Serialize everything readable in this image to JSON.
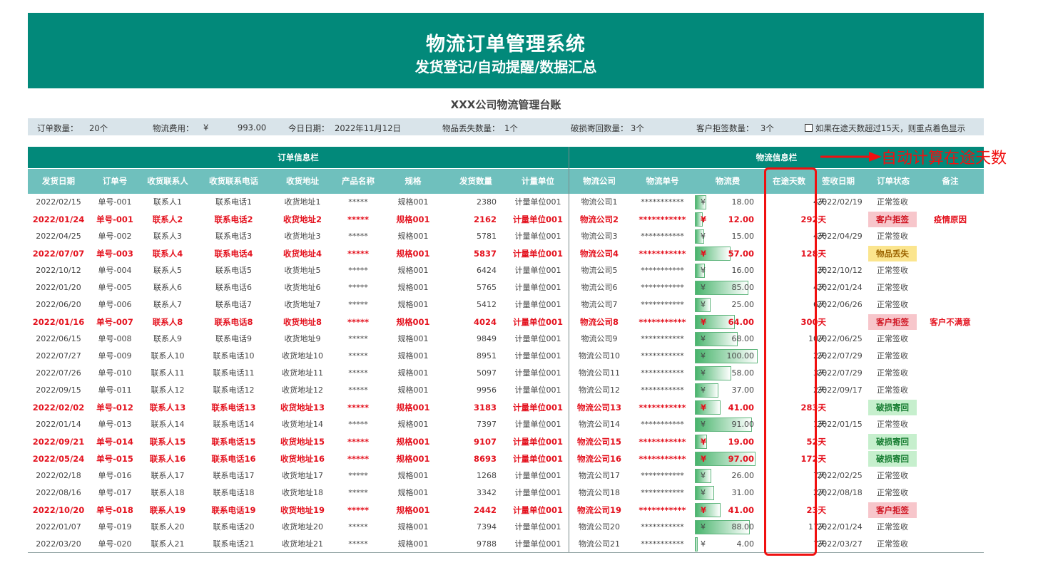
{
  "banner": {
    "title": "物流订单管理系统",
    "subtitle": "发货登记/自动提醒/数据汇总"
  },
  "ledger_title": "XXX公司物流管理台账",
  "summary": {
    "order_count_label": "订单数量：",
    "order_count": "20个",
    "fee_label": "物流费用：",
    "fee_currency": "¥",
    "fee_value": "993.00",
    "today_label": "今日日期：",
    "today_value": "2022年11月12日",
    "lost_label": "物品丢失数量：",
    "lost_value": "1个",
    "damaged_label": "破损寄回数量：",
    "damaged_value": "3个",
    "rejected_label": "客户拒签数量：",
    "rejected_value": "3个",
    "highlight_option": "如果在途天数超过15天，则重点着色显示"
  },
  "sections": {
    "order": "订单信息栏",
    "logistics": "物流信息栏"
  },
  "columns": [
    "发货日期",
    "订单号",
    "收货联系人",
    "收货联系电话",
    "收货地址",
    "产品名称",
    "规格",
    "发货数量",
    "计量单位",
    "物流公司",
    "物流单号",
    "物流费",
    "在途天数",
    "签收日期",
    "订单状态",
    "备注"
  ],
  "annotation": "自动计算在途天数",
  "colors": {
    "header_dark": "#02897a",
    "header_light": "#6fc0bd",
    "highlight_text": "#e4121e",
    "annotation": "#f01010"
  },
  "fee_max": 100,
  "rows": [
    {
      "hl": false,
      "date": "2022/02/15",
      "order": "单号-001",
      "contact": "联系人1",
      "phone": "联系电话1",
      "addr": "收货地址1",
      "product": "*****",
      "spec": "规格001",
      "qty": "2380",
      "unit": "计量单位001",
      "company": "物流公司1",
      "track": "***********",
      "yen": "¥",
      "fee": "18.00",
      "fee_value": 18,
      "days": "4天",
      "sign": "2022/02/19",
      "status": "正常签收",
      "status_type": "",
      "note": ""
    },
    {
      "hl": true,
      "date": "2022/01/24",
      "order": "单号-001",
      "contact": "联系人2",
      "phone": "联系电话2",
      "addr": "收货地址2",
      "product": "*****",
      "spec": "规格001",
      "qty": "2162",
      "unit": "计量单位001",
      "company": "物流公司2",
      "track": "***********",
      "yen": "¥",
      "fee": "12.00",
      "fee_value": 12,
      "days": "292天",
      "sign": "",
      "status": "客户拒签",
      "status_type": "reject",
      "note": "疫情原因"
    },
    {
      "hl": false,
      "date": "2022/04/25",
      "order": "单号-002",
      "contact": "联系人3",
      "phone": "联系电话3",
      "addr": "收货地址3",
      "product": "*****",
      "spec": "规格001",
      "qty": "5781",
      "unit": "计量单位001",
      "company": "物流公司3",
      "track": "***********",
      "yen": "¥",
      "fee": "15.00",
      "fee_value": 15,
      "days": "4天",
      "sign": "2022/04/29",
      "status": "正常签收",
      "status_type": "",
      "note": ""
    },
    {
      "hl": true,
      "date": "2022/07/07",
      "order": "单号-003",
      "contact": "联系人4",
      "phone": "联系电话4",
      "addr": "收货地址4",
      "product": "*****",
      "spec": "规格001",
      "qty": "5837",
      "unit": "计量单位001",
      "company": "物流公司4",
      "track": "***********",
      "yen": "¥",
      "fee": "57.00",
      "fee_value": 57,
      "days": "128天",
      "sign": "",
      "status": "物品丢失",
      "status_type": "lost",
      "note": ""
    },
    {
      "hl": false,
      "date": "2022/10/12",
      "order": "单号-004",
      "contact": "联系人5",
      "phone": "联系电话5",
      "addr": "收货地址5",
      "product": "*****",
      "spec": "规格001",
      "qty": "6424",
      "unit": "计量单位001",
      "company": "物流公司5",
      "track": "***********",
      "yen": "¥",
      "fee": "16.00",
      "fee_value": 16,
      "days": "天",
      "sign": "2022/10/12",
      "status": "正常签收",
      "status_type": "",
      "note": ""
    },
    {
      "hl": false,
      "date": "2022/01/20",
      "order": "单号-005",
      "contact": "联系人6",
      "phone": "联系电话6",
      "addr": "收货地址6",
      "product": "*****",
      "spec": "规格001",
      "qty": "5765",
      "unit": "计量单位001",
      "company": "物流公司6",
      "track": "***********",
      "yen": "¥",
      "fee": "85.00",
      "fee_value": 85,
      "days": "4天",
      "sign": "2022/01/24",
      "status": "正常签收",
      "status_type": "",
      "note": ""
    },
    {
      "hl": false,
      "date": "2022/06/20",
      "order": "单号-006",
      "contact": "联系人7",
      "phone": "联系电话7",
      "addr": "收货地址7",
      "product": "*****",
      "spec": "规格001",
      "qty": "5412",
      "unit": "计量单位001",
      "company": "物流公司7",
      "track": "***********",
      "yen": "¥",
      "fee": "25.00",
      "fee_value": 25,
      "days": "6天",
      "sign": "2022/06/26",
      "status": "正常签收",
      "status_type": "",
      "note": ""
    },
    {
      "hl": true,
      "date": "2022/01/16",
      "order": "单号-007",
      "contact": "联系人8",
      "phone": "联系电话8",
      "addr": "收货地址8",
      "product": "*****",
      "spec": "规格001",
      "qty": "4024",
      "unit": "计量单位001",
      "company": "物流公司8",
      "track": "***********",
      "yen": "¥",
      "fee": "64.00",
      "fee_value": 64,
      "days": "300天",
      "sign": "",
      "status": "客户拒签",
      "status_type": "reject",
      "note": "客户不满意"
    },
    {
      "hl": false,
      "date": "2022/06/15",
      "order": "单号-008",
      "contact": "联系人9",
      "phone": "联系电话9",
      "addr": "收货地址9",
      "product": "*****",
      "spec": "规格001",
      "qty": "9849",
      "unit": "计量单位001",
      "company": "物流公司9",
      "track": "***********",
      "yen": "¥",
      "fee": "68.00",
      "fee_value": 68,
      "days": "10天",
      "sign": "2022/06/25",
      "status": "正常签收",
      "status_type": "",
      "note": ""
    },
    {
      "hl": false,
      "date": "2022/07/27",
      "order": "单号-009",
      "contact": "联系人10",
      "phone": "联系电话10",
      "addr": "收货地址10",
      "product": "*****",
      "spec": "规格001",
      "qty": "8951",
      "unit": "计量单位001",
      "company": "物流公司10",
      "track": "***********",
      "yen": "¥",
      "fee": "100.00",
      "fee_value": 100,
      "days": "2天",
      "sign": "2022/07/29",
      "status": "正常签收",
      "status_type": "",
      "note": ""
    },
    {
      "hl": false,
      "date": "2022/07/26",
      "order": "单号-010",
      "contact": "联系人11",
      "phone": "联系电话11",
      "addr": "收货地址11",
      "product": "*****",
      "spec": "规格001",
      "qty": "5097",
      "unit": "计量单位001",
      "company": "物流公司11",
      "track": "***********",
      "yen": "¥",
      "fee": "58.00",
      "fee_value": 58,
      "days": "3天",
      "sign": "2022/07/29",
      "status": "正常签收",
      "status_type": "",
      "note": ""
    },
    {
      "hl": false,
      "date": "2022/09/15",
      "order": "单号-011",
      "contact": "联系人12",
      "phone": "联系电话12",
      "addr": "收货地址12",
      "product": "*****",
      "spec": "规格001",
      "qty": "9956",
      "unit": "计量单位001",
      "company": "物流公司12",
      "track": "***********",
      "yen": "¥",
      "fee": "37.00",
      "fee_value": 37,
      "days": "2天",
      "sign": "2022/09/17",
      "status": "正常签收",
      "status_type": "",
      "note": ""
    },
    {
      "hl": true,
      "date": "2022/02/02",
      "order": "单号-012",
      "contact": "联系人13",
      "phone": "联系电话13",
      "addr": "收货地址13",
      "product": "*****",
      "spec": "规格001",
      "qty": "3183",
      "unit": "计量单位001",
      "company": "物流公司13",
      "track": "***********",
      "yen": "¥",
      "fee": "41.00",
      "fee_value": 41,
      "days": "283天",
      "sign": "",
      "status": "破损寄回",
      "status_type": "damage",
      "note": ""
    },
    {
      "hl": false,
      "date": "2022/01/14",
      "order": "单号-013",
      "contact": "联系人14",
      "phone": "联系电话14",
      "addr": "收货地址14",
      "product": "*****",
      "spec": "规格001",
      "qty": "7397",
      "unit": "计量单位001",
      "company": "物流公司14",
      "track": "***********",
      "yen": "¥",
      "fee": "91.00",
      "fee_value": 91,
      "days": "1天",
      "sign": "2022/01/15",
      "status": "正常签收",
      "status_type": "",
      "note": ""
    },
    {
      "hl": true,
      "date": "2022/09/21",
      "order": "单号-014",
      "contact": "联系人15",
      "phone": "联系电话15",
      "addr": "收货地址15",
      "product": "*****",
      "spec": "规格001",
      "qty": "9107",
      "unit": "计量单位001",
      "company": "物流公司15",
      "track": "***********",
      "yen": "¥",
      "fee": "19.00",
      "fee_value": 19,
      "days": "52天",
      "sign": "",
      "status": "破损寄回",
      "status_type": "damage",
      "note": ""
    },
    {
      "hl": true,
      "date": "2022/05/24",
      "order": "单号-015",
      "contact": "联系人16",
      "phone": "联系电话16",
      "addr": "收货地址16",
      "product": "*****",
      "spec": "规格001",
      "qty": "8693",
      "unit": "计量单位001",
      "company": "物流公司16",
      "track": "***********",
      "yen": "¥",
      "fee": "97.00",
      "fee_value": 97,
      "days": "172天",
      "sign": "",
      "status": "破损寄回",
      "status_type": "damage",
      "note": ""
    },
    {
      "hl": false,
      "date": "2022/02/18",
      "order": "单号-016",
      "contact": "联系人17",
      "phone": "联系电话17",
      "addr": "收货地址17",
      "product": "*****",
      "spec": "规格001",
      "qty": "1268",
      "unit": "计量单位001",
      "company": "物流公司17",
      "track": "***********",
      "yen": "¥",
      "fee": "26.00",
      "fee_value": 26,
      "days": "7天",
      "sign": "2022/02/25",
      "status": "正常签收",
      "status_type": "",
      "note": ""
    },
    {
      "hl": false,
      "date": "2022/08/16",
      "order": "单号-017",
      "contact": "联系人18",
      "phone": "联系电话18",
      "addr": "收货地址18",
      "product": "*****",
      "spec": "规格001",
      "qty": "3342",
      "unit": "计量单位001",
      "company": "物流公司18",
      "track": "***********",
      "yen": "¥",
      "fee": "31.00",
      "fee_value": 31,
      "days": "2天",
      "sign": "2022/08/18",
      "status": "正常签收",
      "status_type": "",
      "note": ""
    },
    {
      "hl": true,
      "date": "2022/10/20",
      "order": "单号-018",
      "contact": "联系人19",
      "phone": "联系电话19",
      "addr": "收货地址19",
      "product": "*****",
      "spec": "规格001",
      "qty": "2442",
      "unit": "计量单位001",
      "company": "物流公司19",
      "track": "***********",
      "yen": "¥",
      "fee": "41.00",
      "fee_value": 41,
      "days": "23天",
      "sign": "",
      "status": "客户拒签",
      "status_type": "reject",
      "note": ""
    },
    {
      "hl": false,
      "date": "2022/01/07",
      "order": "单号-019",
      "contact": "联系人20",
      "phone": "联系电话20",
      "addr": "收货地址20",
      "product": "*****",
      "spec": "规格001",
      "qty": "7394",
      "unit": "计量单位001",
      "company": "物流公司20",
      "track": "***********",
      "yen": "¥",
      "fee": "88.00",
      "fee_value": 88,
      "days": "17天",
      "sign": "2022/01/24",
      "status": "正常签收",
      "status_type": "",
      "note": ""
    },
    {
      "hl": false,
      "date": "2022/03/20",
      "order": "单号-020",
      "contact": "联系人21",
      "phone": "联系电话21",
      "addr": "收货地址21",
      "product": "*****",
      "spec": "规格001",
      "qty": "9788",
      "unit": "计量单位001",
      "company": "物流公司21",
      "track": "***********",
      "yen": "¥",
      "fee": "4.00",
      "fee_value": 4,
      "days": "7天",
      "sign": "2022/03/27",
      "status": "正常签收",
      "status_type": "",
      "note": ""
    }
  ]
}
